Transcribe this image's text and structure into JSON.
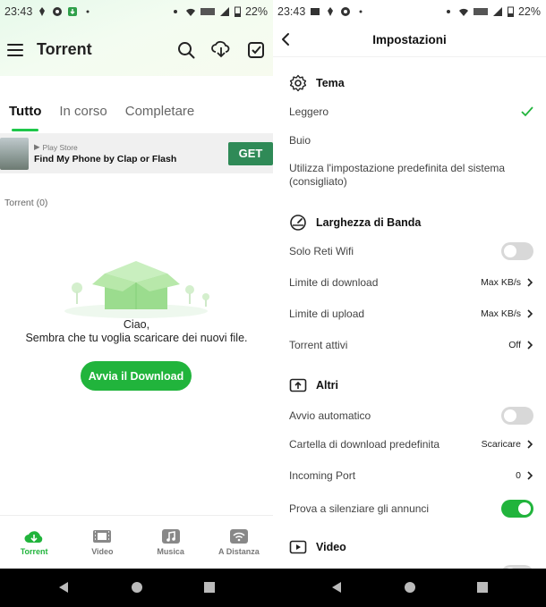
{
  "status_left": {
    "time": "23:43",
    "battery": "22%"
  },
  "status_right": {
    "time": "23:43",
    "battery": "22%"
  },
  "left": {
    "title": "Torrent",
    "tabs": [
      "Tutto",
      "In corso",
      "Completare"
    ],
    "ad": {
      "store": "Play Store",
      "title": "Find My Phone by Clap or Flash",
      "button": "GET"
    },
    "torrent_count": "Torrent (0)",
    "empty_line1": "Ciao,",
    "empty_line2": "Sembra che tu voglia scaricare dei nuovi file.",
    "download_button": "Avvia il Download",
    "nav": [
      "Torrent",
      "Video",
      "Musica",
      "A Distanza"
    ]
  },
  "right": {
    "title": "Impostazioni",
    "tema": {
      "label": "Tema",
      "options": [
        "Leggero",
        "Buio",
        "Utilizza l'impostazione predefinita del sistema",
        "(consigliato)"
      ]
    },
    "banda": {
      "label": "Larghezza di Banda",
      "wifi": "Solo Reti Wifi",
      "download_limit": "Limite di download",
      "download_value": "Max KB/s",
      "upload_limit": "Limite di upload",
      "upload_value": "Max KB/s",
      "active": "Torrent attivi",
      "active_value": "Off"
    },
    "altri": {
      "label": "Altri",
      "autostart": "Avvio automatico",
      "folder": "Cartella di download predefinita",
      "folder_value": "Scaricare",
      "port": "Incoming Port",
      "port_value": "0",
      "mute_ads": "Prova a silenziare gli annunci"
    },
    "video": {
      "label": "Video"
    },
    "toggles": {
      "wifi_only": false,
      "autostart": false,
      "mute_ads": true
    }
  },
  "colors": {
    "accent": "#21b43c",
    "ad_button": "#2f8a57"
  }
}
